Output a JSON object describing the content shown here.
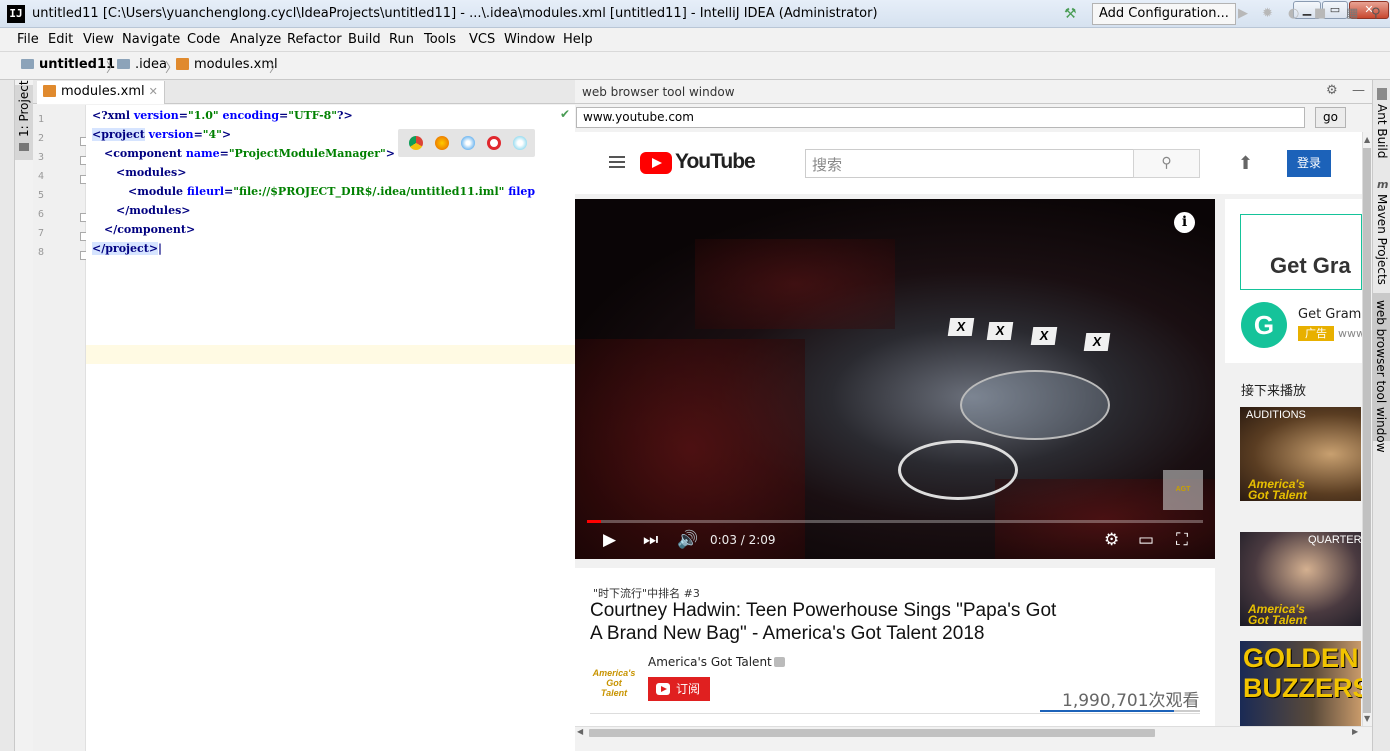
{
  "window": {
    "title": "untitled11 [C:\\Users\\yuanchenglong.cycl\\IdeaProjects\\untitled11] - ...\\.idea\\modules.xml [untitled11] - IntelliJ IDEA (Administrator)",
    "app_icon": "IJ"
  },
  "menu": [
    "File",
    "Edit",
    "View",
    "Navigate",
    "Code",
    "Analyze",
    "Refactor",
    "Build",
    "Run",
    "Tools",
    "VCS",
    "Window",
    "Help"
  ],
  "breadcrumb": [
    "untitled11",
    ".idea",
    "modules.xml"
  ],
  "toolbar": {
    "add_config": "Add Configuration..."
  },
  "left_tab": "1: Project",
  "editor": {
    "tab_label": "modules.xml",
    "line_numbers": [
      "1",
      "2",
      "3",
      "4",
      "5",
      "6",
      "7",
      "8"
    ]
  },
  "web": {
    "panel_title": "web browser tool window",
    "url": "www.youtube.com",
    "go_label": "go",
    "youtube": {
      "logo_text": "YouTube",
      "search_placeholder": "搜索",
      "login": "登录",
      "time": "0:03 / 2:09",
      "progress": 0.023,
      "rank": "\"时下流行\"中排名 #3",
      "title": "Courtney Hadwin: Teen Powerhouse Sings \"Papa's Got A Brand New Bag\" - America's Got Talent 2018",
      "channel": "America's Got Talent",
      "channel_logo": "America's Got Talent",
      "subscribe": "订阅",
      "views": "1,990,701次观看",
      "like_ratio": 0.84
    },
    "sidebar": {
      "ad_banner": "Get Gra",
      "ad_logo": "G",
      "ad_title": "Get Gramm",
      "ad_badge": "广告",
      "ad_url": "www",
      "up_next": "接下来播放",
      "thumb1_label": "AUDITIONS",
      "thumb2_label": "QUARTER",
      "thumb3_text": "GOLDEN BUZZERS!"
    }
  },
  "right_tabs": [
    "Ant Build",
    "Maven Projects",
    "web browser tool window"
  ]
}
